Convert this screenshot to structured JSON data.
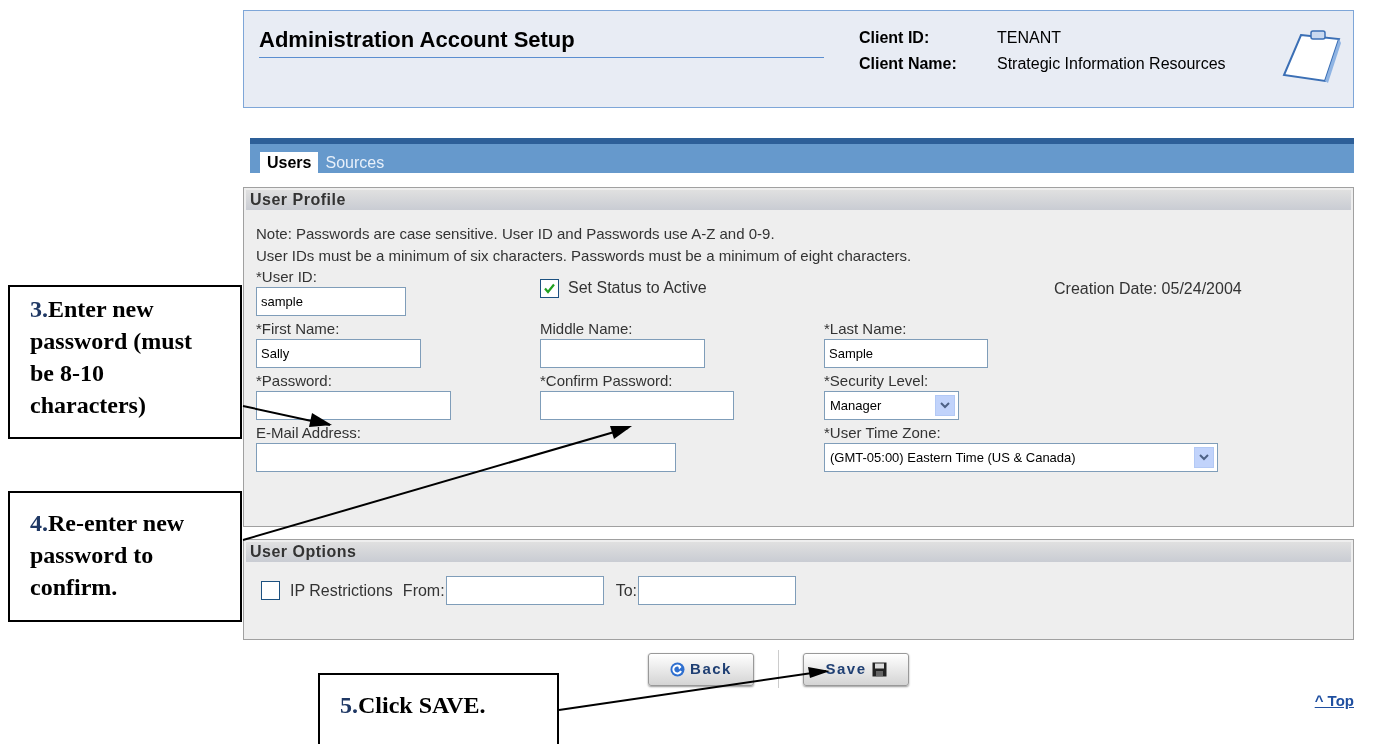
{
  "header": {
    "title": "Administration Account Setup",
    "client_id_label": "Client ID:",
    "client_id": "TENANT",
    "client_name_label": "Client Name:",
    "client_name": "Strategic Information Resources"
  },
  "tabs": [
    {
      "label": "Users",
      "selected": true
    },
    {
      "label": "Sources",
      "selected": false
    }
  ],
  "user_profile": {
    "title": "User Profile",
    "notes": [
      "Note: Passwords are case sensitive. User ID and Passwords use A-Z and 0-9.",
      "User IDs must be a minimum of six characters.   Passwords must be a minimum of eight characters."
    ],
    "user_id": {
      "label": "*User ID:",
      "value": "sample"
    },
    "status": {
      "label": "Set Status to Active",
      "checked": true
    },
    "creation_date": "Creation Date: 05/24/2004",
    "first_name": {
      "label": "*First Name:",
      "value": "Sally"
    },
    "middle_name": {
      "label": "Middle Name:"
    },
    "last_name": {
      "label": "*Last Name:",
      "value": "Sample"
    },
    "password": {
      "label": "*Password:"
    },
    "confirm_password": {
      "label": "*Confirm Password:"
    },
    "security_level": {
      "label": "*Security Level:",
      "value": "Manager"
    },
    "email": {
      "label": "E-Mail Address:"
    },
    "time_zone": {
      "label": "*User Time Zone:",
      "value": "(GMT-05:00) Eastern Time (US & Canada)"
    }
  },
  "user_options": {
    "title": "User Options",
    "ip_restrictions": {
      "label": "IP Restrictions",
      "checked": false
    },
    "from_label": "From:",
    "to_label": "To:"
  },
  "buttons": [
    {
      "kind": "back",
      "label": "Back"
    },
    {
      "kind": "save",
      "label": "Save"
    }
  ],
  "top_link": "^ Top",
  "callouts": [
    {
      "number": "3.",
      "text": "Enter new password (must be 8-10 characters)"
    },
    {
      "number": "4.",
      "text": "Re-enter new password to confirm."
    },
    {
      "number": "5.",
      "text": "Click SAVE."
    }
  ]
}
